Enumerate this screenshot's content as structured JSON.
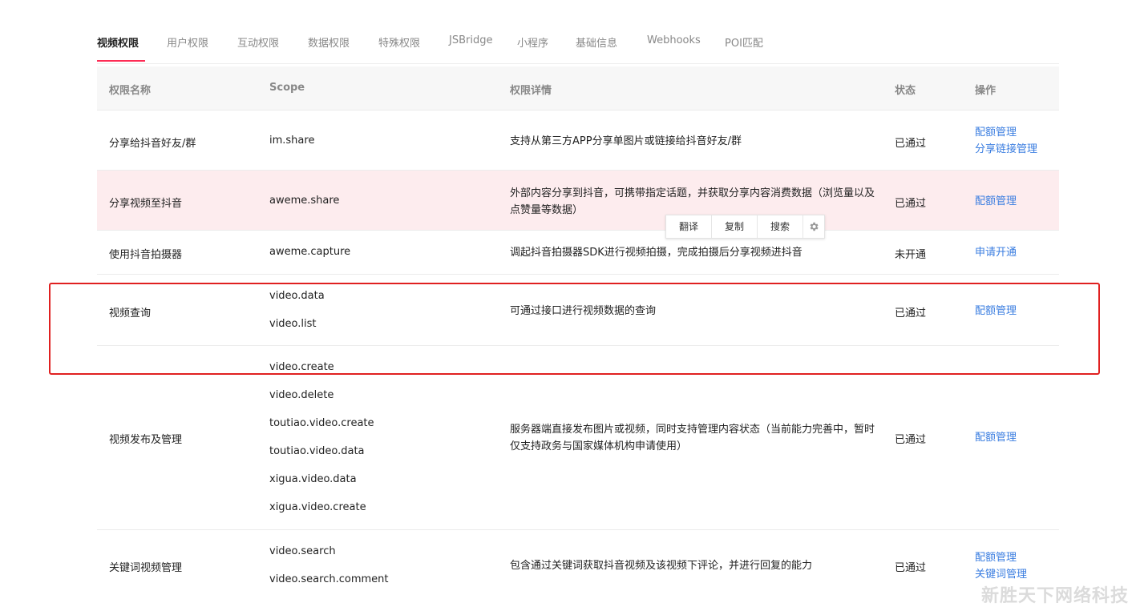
{
  "tabs": [
    "视频权限",
    "用户权限",
    "互动权限",
    "数据权限",
    "特殊权限",
    "JSBridge",
    "小程序",
    "基础信息",
    "Webhooks",
    "POI匹配"
  ],
  "table": {
    "headers": {
      "name": "权限名称",
      "scope": "Scope",
      "detail": "权限详情",
      "status": "状态",
      "ops": "操作"
    },
    "rows": [
      {
        "name": "分享给抖音好友/群",
        "scopes": [
          "im.share"
        ],
        "detail": "支持从第三方APP分享单图片或链接给抖音好友/群",
        "status": "已通过",
        "ops": [
          "配额管理",
          "分享链接管理"
        ]
      },
      {
        "name": "分享视频至抖音",
        "scopes": [
          "aweme.share"
        ],
        "detail": "外部内容分享到抖音，可携带指定话题，并获取分享内容消费数据（浏览量以及点赞量等数据）",
        "status": "已通过",
        "ops": [
          "配额管理"
        ]
      },
      {
        "name": "使用抖音拍摄器",
        "scopes": [
          "aweme.capture"
        ],
        "detail": "调起抖音拍摄器SDK进行视频拍摄，完成拍摄后分享视频进抖音",
        "status": "未开通",
        "ops": [
          "申请开通"
        ]
      },
      {
        "name": "视频查询",
        "scopes": [
          "video.data",
          "video.list"
        ],
        "detail": "可通过接口进行视频数据的查询",
        "status": "已通过",
        "ops": [
          "配额管理"
        ]
      },
      {
        "name": "视频发布及管理",
        "scopes": [
          "video.create",
          "video.delete",
          "toutiao.video.create",
          "toutiao.video.data",
          "xigua.video.data",
          "xigua.video.create"
        ],
        "detail": "服务器端直接发布图片或视频，同时支持管理内容状态（当前能力完善中，暂时仅支持政务与国家媒体机构申请使用）",
        "status": "已通过",
        "ops": [
          "配额管理"
        ]
      },
      {
        "name": "关键词视频管理",
        "scopes": [
          "video.search",
          "video.search.comment"
        ],
        "detail": "包含通过关键词获取抖音视频及该视频下评论，并进行回复的能力",
        "status": "已通过",
        "ops": [
          "配额管理",
          "关键词管理"
        ]
      }
    ]
  },
  "context_menu": {
    "items": [
      "翻译",
      "复制",
      "搜索"
    ],
    "settings_icon": "gear-icon"
  },
  "watermark": "新胜天下网络科技",
  "colors": {
    "accent": "#fe2c55",
    "link": "#3a7de0",
    "highlight_row": "#fdecee",
    "annotation_box": "#e02020"
  }
}
